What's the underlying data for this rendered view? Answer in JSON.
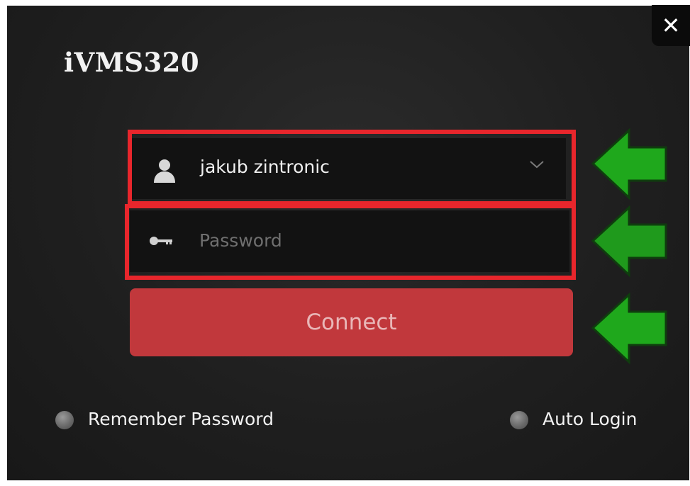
{
  "app": {
    "title": "iVMS320",
    "close_label": "✕"
  },
  "login": {
    "username": "jakub zintronic",
    "password_placeholder": "Password",
    "password_value": "",
    "connect_label": "Connect"
  },
  "options": {
    "remember_password": "Remember Password",
    "auto_login": "Auto Login"
  },
  "colors": {
    "highlight": "#e8262c",
    "connect_button": "#c1383c",
    "arrow": "#1fa81c",
    "background": "#1f1f1f"
  },
  "icons": [
    "user-icon",
    "key-icon",
    "chevron-down-icon",
    "close-icon",
    "green-arrow-left-icon"
  ]
}
